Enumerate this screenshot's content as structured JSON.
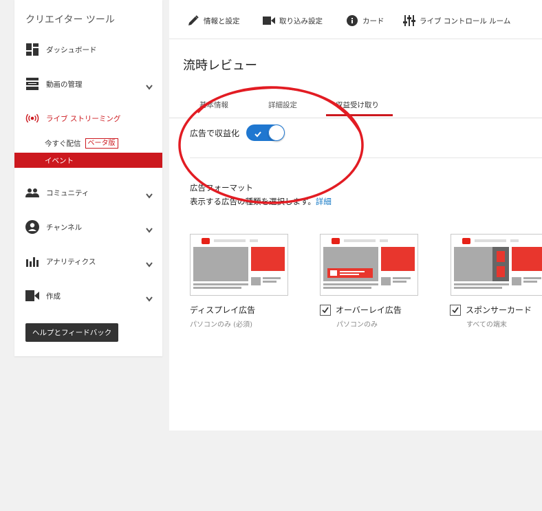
{
  "sidebar": {
    "title": "クリエイター ツール",
    "items": [
      {
        "label": "ダッシュボード",
        "icon": "dashboard-icon"
      },
      {
        "label": "動画の管理",
        "icon": "video-manager-icon"
      },
      {
        "label": "ライブ ストリーミング",
        "icon": "live-icon"
      },
      {
        "label": "コミュニティ",
        "icon": "community-icon"
      },
      {
        "label": "チャンネル",
        "icon": "channel-icon"
      },
      {
        "label": "アナリティクス",
        "icon": "analytics-icon"
      },
      {
        "label": "作成",
        "icon": "create-icon"
      }
    ],
    "sub": {
      "now_label": "今すぐ配信",
      "beta": "ベータ版",
      "events_label": "イベント"
    },
    "help_button": "ヘルプとフィードバック"
  },
  "toolbar": {
    "info_settings": "情報と設定",
    "ingest_settings": "取り込み設定",
    "cards": "カード",
    "live_control_room": "ライブ コントロール ルーム"
  },
  "main": {
    "title": "流時レビュー",
    "tabs": [
      "基本情報",
      "詳細設定",
      "収益受け取り"
    ],
    "active_tab": "収益受け取り",
    "monetize_label": "広告で収益化",
    "monetize_enabled": true,
    "ad_formats_title": "広告フォーマット",
    "ad_formats_desc": "表示する広告の種類を選択します。",
    "details_link": "詳細",
    "formats": [
      {
        "name": "ディスプレイ広告",
        "note": "パソコンのみ (必須)",
        "checkbox": false
      },
      {
        "name": "オーバーレイ広告",
        "note": "パソコンのみ",
        "checkbox": true,
        "checked": true
      },
      {
        "name": "スポンサーカード",
        "note": "すべての端末",
        "checkbox": true,
        "checked": true
      }
    ]
  },
  "colors": {
    "accent_red": "#cc181e",
    "toggle_blue": "#1f77d0",
    "link_blue": "#167ac6"
  }
}
